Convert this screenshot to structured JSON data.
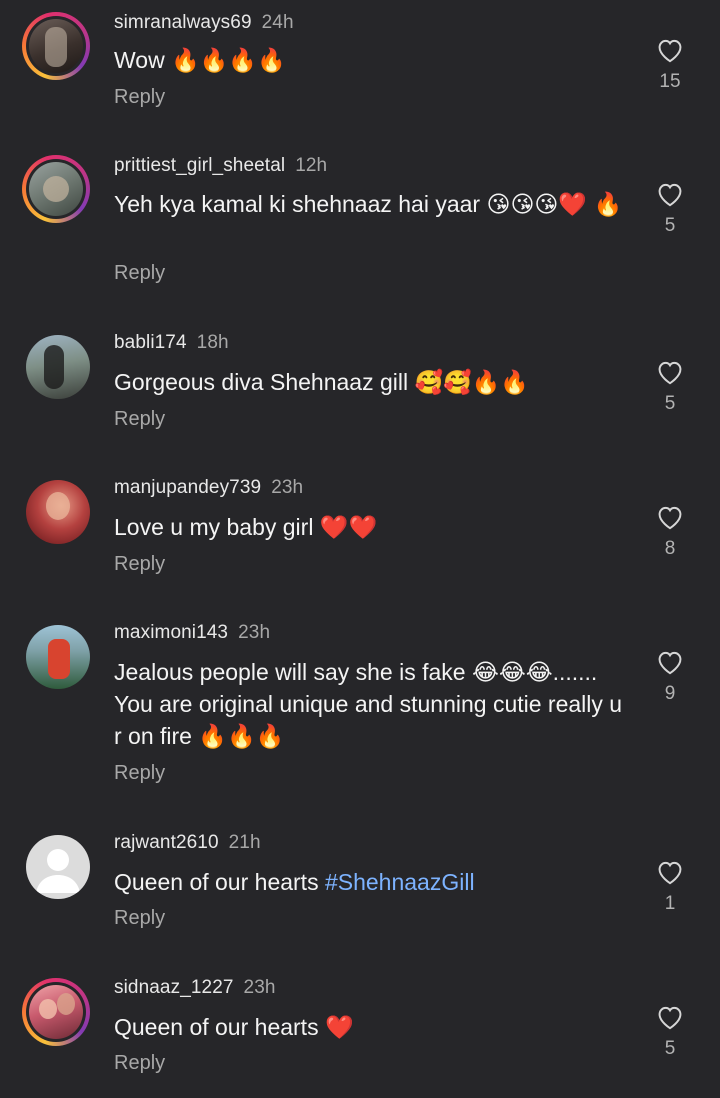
{
  "comments": [
    {
      "username": "simranalways69",
      "time": "24h",
      "text": "Wow 🔥🔥🔥🔥",
      "reply": "Reply",
      "likes": "15",
      "avatar": "story-photo"
    },
    {
      "username": "prittiest_girl_sheetal",
      "time": "12h",
      "text": "Yeh kya kamal ki shehnaaz hai yaar 😘😘😘❤️ 🔥",
      "reply": "Reply",
      "likes": "5",
      "avatar": "story-photo"
    },
    {
      "username": "babli174",
      "time": "18h",
      "text": "Gorgeous diva Shehnaaz gill 🥰🥰🔥🔥",
      "reply": "Reply",
      "likes": "5",
      "avatar": "photo"
    },
    {
      "username": "manjupandey739",
      "time": "23h",
      "text": "Love u my baby girl ❤️❤️",
      "reply": "Reply",
      "likes": "8",
      "avatar": "photo"
    },
    {
      "username": "maximoni143",
      "time": "23h",
      "text": "Jealous people will say she is fake 😂😂😂....... You are original unique and stunning cutie really u r on fire 🔥🔥🔥",
      "reply": "Reply",
      "likes": "9",
      "avatar": "photo"
    },
    {
      "username": "rajwant2610",
      "time": "21h",
      "text_plain": "Queen of our hearts ",
      "hashtag": "#ShehnaazGill",
      "reply": "Reply",
      "likes": "1",
      "avatar": "default-avatar"
    },
    {
      "username": "sidnaaz_1227",
      "time": "23h",
      "text": "Queen of our hearts ❤️",
      "reply": "Reply",
      "likes": "5",
      "avatar": "story-photo"
    }
  ],
  "icons": {
    "like": "heart-outline-icon",
    "default_avatar": "person-silhouette-icon"
  },
  "colors": {
    "background": "#262629",
    "text": "#f4f4f4",
    "muted": "#a8a8a8",
    "hashtag": "#7db3ff"
  }
}
